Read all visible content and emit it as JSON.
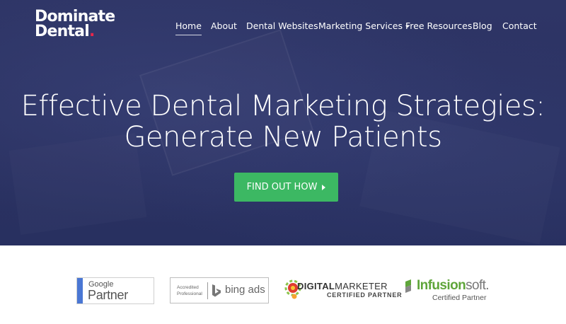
{
  "brand": {
    "line1": "Dominate",
    "line2": "Dental",
    "dot": ".",
    "accent": "#e8264b"
  },
  "nav": {
    "items": [
      {
        "label": "Home",
        "active": true
      },
      {
        "label": "About"
      },
      {
        "label": "Dental Websites"
      },
      {
        "label": "Marketing Services",
        "has_dropdown": true
      },
      {
        "label": "Free Resources"
      },
      {
        "label": "Blog"
      },
      {
        "label": "Contact"
      }
    ]
  },
  "hero": {
    "headline_line1": "Effective Dental Marketing Strategies:",
    "headline_line2": "Generate New Patients",
    "cta_label": "FIND OUT HOW",
    "bg_color": "#2e3566",
    "cta_color": "#3cb863"
  },
  "partners": {
    "google": {
      "brand": "Google",
      "label": "Partner"
    },
    "bing": {
      "accredited": "Accredited",
      "professional": "Professional",
      "label": "bing ads"
    },
    "digital_marketer": {
      "word1": "DIGITAL",
      "word2": "MARKETER",
      "sub": "CERTIFIED PARTNER"
    },
    "infusionsoft": {
      "word1": "Infusion",
      "word2": "soft.",
      "sub": "Certified Partner"
    }
  }
}
